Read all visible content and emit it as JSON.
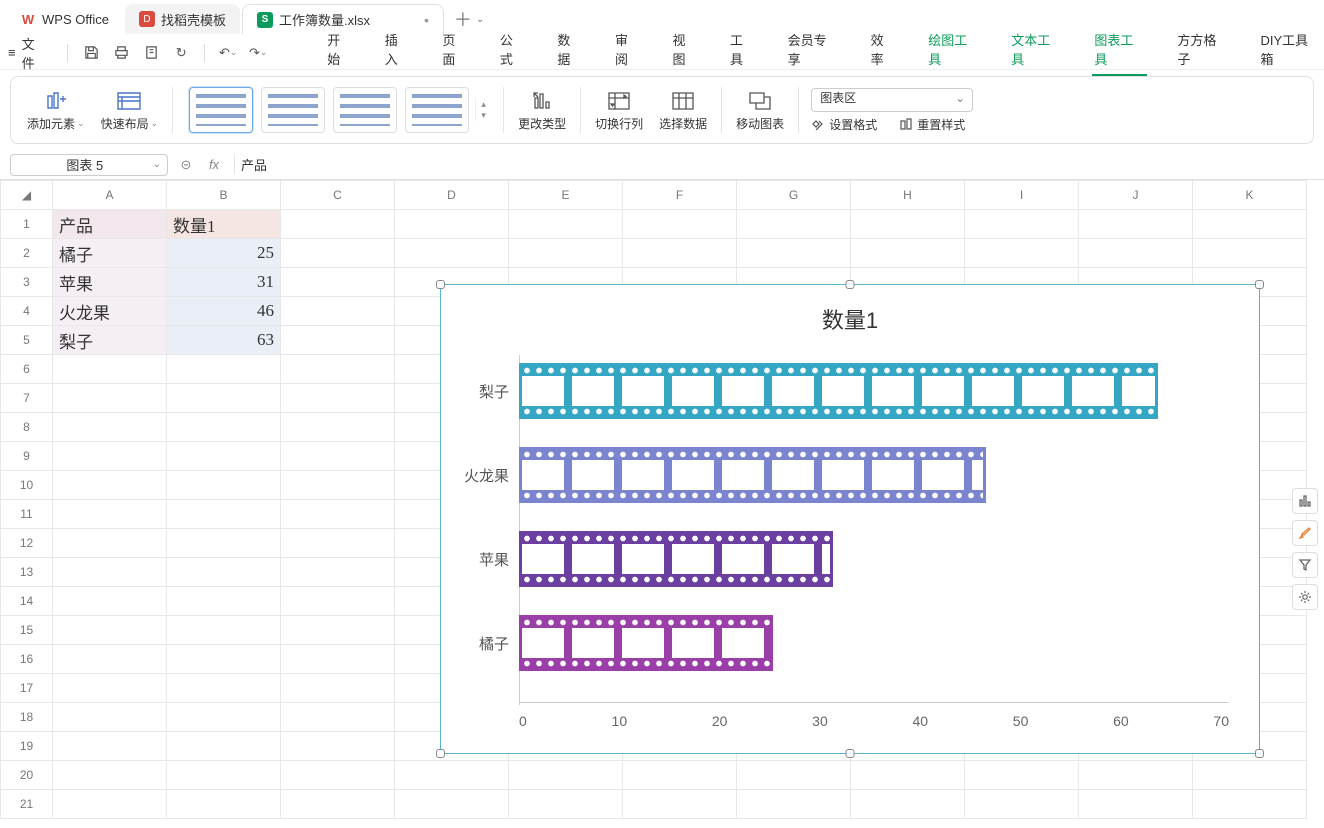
{
  "app": {
    "name": "WPS Office",
    "template_tab": "找稻壳模板",
    "file_tab": "工作簿数量.xlsx"
  },
  "menu": {
    "file": "文件",
    "items": [
      "开始",
      "插入",
      "页面",
      "公式",
      "数据",
      "审阅",
      "视图",
      "工具",
      "会员专享",
      "效率",
      "绘图工具",
      "文本工具",
      "图表工具",
      "方方格子",
      "DIY工具箱"
    ],
    "ctx_idx": [
      10,
      11,
      12
    ],
    "active_idx": 12
  },
  "ribbon": {
    "add_element": "添加元素",
    "quick_layout": "快速布局",
    "change_type": "更改类型",
    "switch_rc": "切换行列",
    "select_data": "选择数据",
    "move_chart": "移动图表",
    "chart_area": "图表区",
    "set_format": "设置格式",
    "reset_style": "重置样式"
  },
  "namebox": "图表 5",
  "formula": "产品",
  "columns": [
    "A",
    "B",
    "C",
    "D",
    "E",
    "F",
    "G",
    "H",
    "I",
    "J",
    "K"
  ],
  "rows": 21,
  "cells": {
    "A1": "产品",
    "B1": "数量1",
    "A2": "橘子",
    "B2": "25",
    "A3": "苹果",
    "B3": "31",
    "A4": "火龙果",
    "B4": "46",
    "A5": "梨子",
    "B5": "63"
  },
  "chart_data": {
    "type": "bar",
    "title": "数量1",
    "categories": [
      "梨子",
      "火龙果",
      "苹果",
      "橘子"
    ],
    "values": [
      63,
      46,
      31,
      25
    ],
    "colors": [
      "#35a7c4",
      "#7b84ce",
      "#6b3fa0",
      "#9b3fa8"
    ],
    "xlim": [
      0,
      70
    ],
    "xticks": [
      0,
      10,
      20,
      30,
      40,
      50,
      60,
      70
    ]
  }
}
